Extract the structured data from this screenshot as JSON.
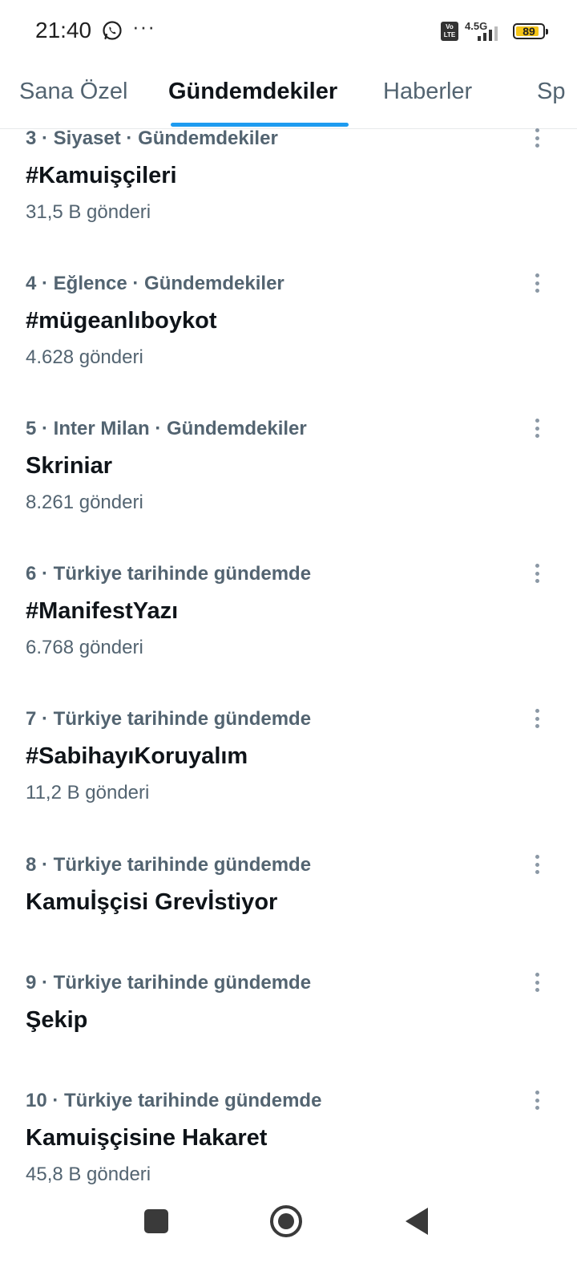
{
  "status_bar": {
    "time": "21:40",
    "notification_icons": [
      "whatsapp-icon",
      "more-dots-icon"
    ],
    "dots": "···",
    "volte": "Vo LTE",
    "network": "4.5G",
    "signal_level": 0.75,
    "battery": "89",
    "battery_level": 0.89,
    "battery_color": "#f5c518"
  },
  "tabs": [
    {
      "label": "Sana Özel",
      "active": false
    },
    {
      "label": "Gündemdekiler",
      "active": true
    },
    {
      "label": "Haberler",
      "active": false
    },
    {
      "label": "Sp",
      "active": false
    }
  ],
  "accent_color": "#1d9bf0",
  "trends": [
    {
      "meta": "3 · Siyaset · Gündemdekiler",
      "name": "#Kamuişçileri",
      "count": "31,5 B gönderi"
    },
    {
      "meta": "4 · Eğlence · Gündemdekiler",
      "name": "#mügeanlıboykot",
      "count": "4.628 gönderi"
    },
    {
      "meta": "5 · Inter Milan · Gündemdekiler",
      "name": "Skriniar",
      "count": "8.261 gönderi"
    },
    {
      "meta": "6 · Türkiye tarihinde gündemde",
      "name": "#ManifestYazı",
      "count": "6.768 gönderi"
    },
    {
      "meta": "7 · Türkiye tarihinde gündemde",
      "name": "#SabihayıKoruyalım",
      "count": "11,2 B gönderi"
    },
    {
      "meta": "8 · Türkiye tarihinde gündemde",
      "name": "Kamuİşçisi Grevİstiyor",
      "count": ""
    },
    {
      "meta": "9 · Türkiye tarihinde gündemde",
      "name": "Şekip",
      "count": ""
    },
    {
      "meta": "10 · Türkiye tarihinde gündemde",
      "name": "Kamuişçisine Hakaret",
      "count": "45,8 B gönderi"
    }
  ],
  "nav_bar": {
    "icons": [
      "recent-apps-icon",
      "home-icon",
      "back-icon"
    ]
  }
}
